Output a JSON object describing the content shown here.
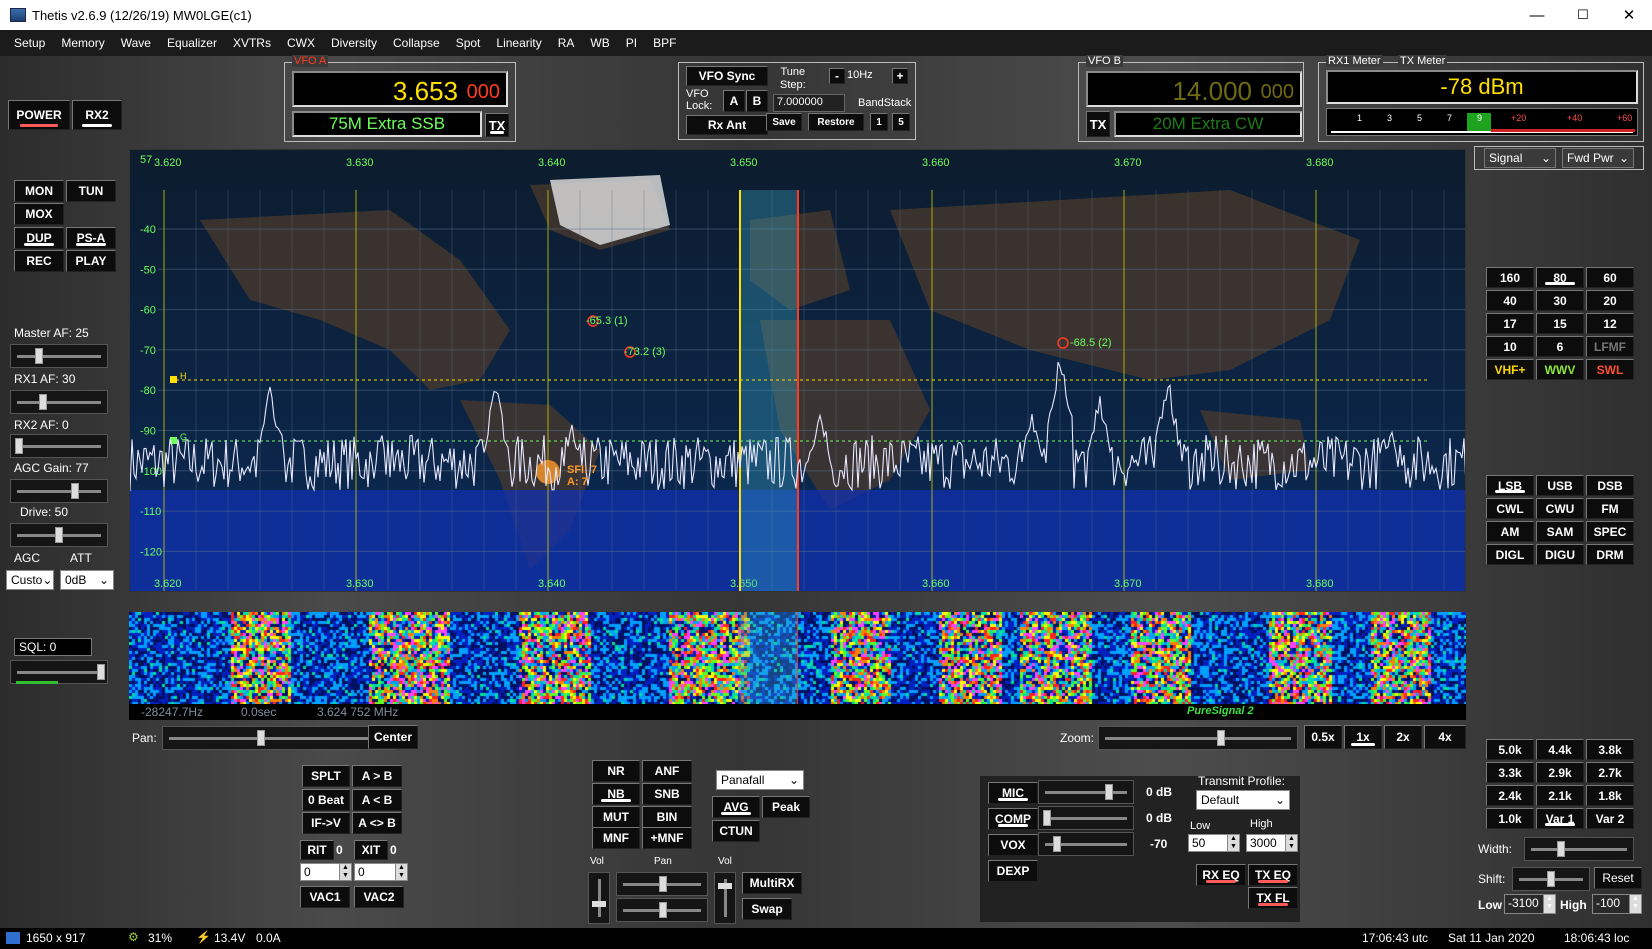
{
  "window": {
    "title": "Thetis v2.6.9 (12/26/19) MW0LGE(c1)",
    "minimize": "—",
    "maximize": "☐",
    "close": "✕"
  },
  "menu": [
    "Setup",
    "Memory",
    "Wave",
    "Equalizer",
    "XVTRs",
    "CWX",
    "Diversity",
    "Collapse",
    "Spot",
    "Linearity",
    "RA",
    "WB",
    "PI",
    "BPF"
  ],
  "vfoA": {
    "label": "VFO A",
    "freq_main": "3.653",
    "freq_sub": "000",
    "band": "75M Extra SSB",
    "tx": "TX"
  },
  "vfoB": {
    "label": "VFO B",
    "freq_main": "14.000",
    "freq_sub": "000",
    "band": "20M Extra CW",
    "tx": "TX"
  },
  "center": {
    "vfo_sync": "VFO Sync",
    "vfo_lock": "VFO\nLock:",
    "lock_a": "A",
    "lock_b": "B",
    "rx_ant": "Rx Ant",
    "tune_step_label": "Tune\nStep:",
    "tune_minus": "-",
    "tune_step": "10Hz",
    "tune_plus": "+",
    "freq_entry": "7.000000",
    "bandstack": "BandStack",
    "save": "Save",
    "restore": "Restore",
    "bs1": "1",
    "bs5": "5"
  },
  "meter": {
    "rx_label": "RX1 Meter",
    "tx_label": "TX Meter",
    "reading": "-78 dBm",
    "scale": [
      "1",
      "3",
      "5",
      "7",
      "9",
      "+20",
      "+40",
      "+60"
    ],
    "rx_mode": "Signal",
    "tx_mode": "Fwd Pwr"
  },
  "power": {
    "power": "POWER",
    "rx2": "RX2"
  },
  "left_buttons": {
    "mon": "MON",
    "tun": "TUN",
    "mox": "MOX",
    "dup": "DUP",
    "psa": "PS-A",
    "rec": "REC",
    "play": "PLAY"
  },
  "left_controls": {
    "master_af": "Master AF:  25",
    "rx1_af": "RX1 AF:  30",
    "rx2_af": "RX2 AF:  0",
    "agc_gain": "AGC Gain:  77",
    "drive": "Drive:  50",
    "agc": "AGC",
    "att": "ATT",
    "agc_val": "Custo",
    "att_val": "0dB",
    "sql": "SQL:  0"
  },
  "spectrum": {
    "corner": "57",
    "freq_ticks": [
      "3.620",
      "3.630",
      "3.640",
      "3.650",
      "3.660",
      "3.670",
      "3.680"
    ],
    "db_ticks": [
      "-40",
      "-50",
      "-60",
      "-70",
      "-80",
      "-90",
      "-100",
      "-110",
      "-120"
    ],
    "spot1": "-65.3 (1)",
    "spot2": "-73.2 (3)",
    "spot3": "-68.5 (2)",
    "sfi": "SFI: 7",
    "a_index": "A: 7",
    "marker_h": "H",
    "marker_g": "G"
  },
  "waterfall": {
    "offset": "-28247.7Hz",
    "time": "0.0sec",
    "freq": "3.624 752 MHz",
    "puresignal": "PureSignal 2"
  },
  "pan": {
    "label": "Pan:",
    "center": "Center",
    "zoom_label": "Zoom:",
    "zooms": [
      "0.5x",
      "1x",
      "2x",
      "4x"
    ]
  },
  "bands": [
    "160",
    "80",
    "60",
    "40",
    "30",
    "20",
    "17",
    "15",
    "12",
    "10",
    "6",
    "LFMF",
    "VHF+",
    "WWV",
    "SWL"
  ],
  "modes": [
    "LSB",
    "USB",
    "DSB",
    "CWL",
    "CWU",
    "FM",
    "AM",
    "SAM",
    "SPEC",
    "DIGL",
    "DIGU",
    "DRM"
  ],
  "filters": [
    "5.0k",
    "4.4k",
    "3.8k",
    "3.3k",
    "2.9k",
    "2.7k",
    "2.4k",
    "2.1k",
    "1.8k",
    "1.0k",
    "Var 1",
    "Var 2"
  ],
  "filter_controls": {
    "width": "Width:",
    "shift": "Shift:",
    "reset": "Reset",
    "low_label": "Low",
    "low_val": "-3100",
    "high_label": "High",
    "high_val": "-100"
  },
  "rit": {
    "splt": "SPLT",
    "a_to_b": "A > B",
    "zero_beat": "0 Beat",
    "a_from_b": "A < B",
    "if_v": "IF->V",
    "a_swap_b": "A <> B",
    "rit": "RIT",
    "rit_val": "0",
    "xit": "XIT",
    "xit_val": "0",
    "rit_input": "0",
    "xit_input": "0",
    "vac1": "VAC1",
    "vac2": "VAC2"
  },
  "dsp": {
    "nr": "NR",
    "anf": "ANF",
    "nb": "NB",
    "snb": "SNB",
    "mut": "MUT",
    "bin": "BIN",
    "mnf": "MNF",
    "plus_mnf": "+MNF",
    "display": "Panafall",
    "avg": "AVG",
    "peak": "Peak",
    "ctun": "CTUN",
    "vol1": "Vol",
    "pan": "Pan",
    "vol2": "Vol",
    "multirx": "MultiRX",
    "swap": "Swap"
  },
  "tx": {
    "mic": "MIC",
    "mic_db": "0 dB",
    "comp": "COMP",
    "comp_db": "0 dB",
    "vox": "VOX",
    "vox_db": "-70",
    "dexp": "DEXP",
    "profile_label": "Transmit Profile:",
    "profile": "Default",
    "low_label": "Low",
    "low": "50",
    "high_label": "High",
    "high": "3000",
    "rx_eq": "RX EQ",
    "tx_eq": "TX EQ",
    "tx_fl": "TX FL"
  },
  "status": {
    "res": "1650 x 917",
    "cpu": "31%",
    "volt": "13.4V",
    "amp": "0.0A",
    "utc": "17:06:43 utc",
    "date": "Sat 11 Jan 2020",
    "loc": "18:06:43 loc"
  },
  "colors": {
    "accent_yellow": "#ffe000",
    "vfo_red": "#ff3b1f",
    "spectrum_blue": "#1030b0",
    "trace": "#e8e8ff",
    "green_text": "#6dff5a",
    "orange": "#ff9a2a"
  }
}
